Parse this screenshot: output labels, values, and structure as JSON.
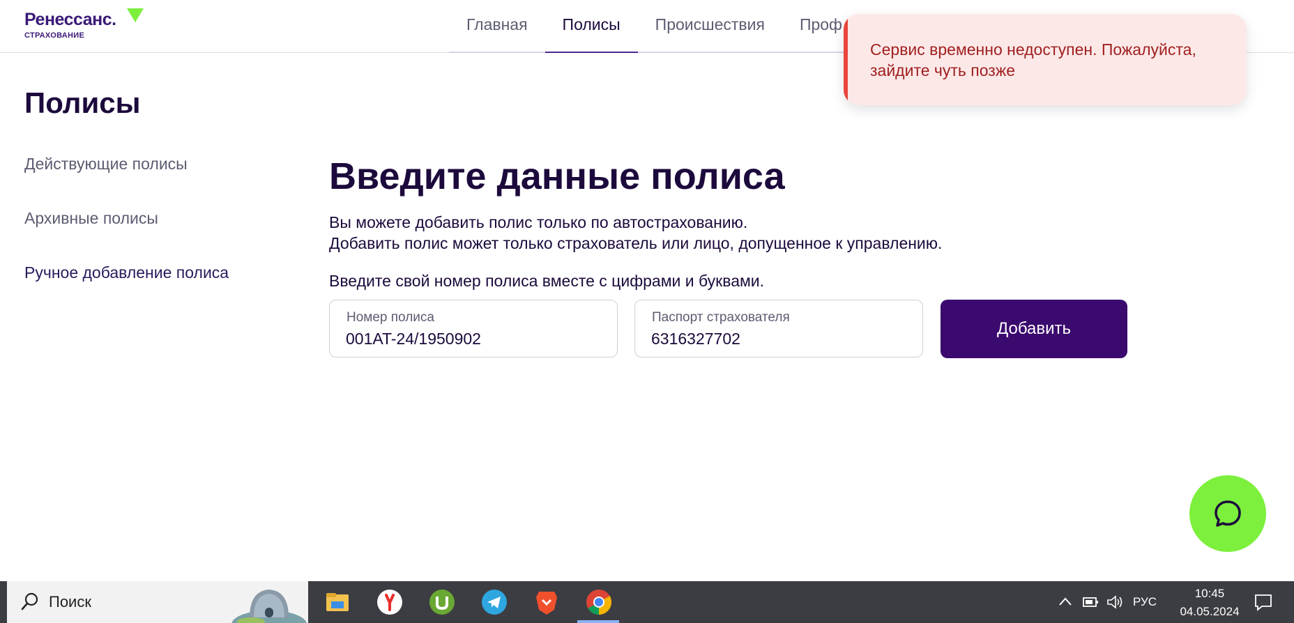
{
  "logo": {
    "name": "Ренессанс.",
    "sub": "СТРАХОВАНИЕ"
  },
  "nav": {
    "items": [
      {
        "label": "Главная"
      },
      {
        "label": "Полисы"
      },
      {
        "label": "Происшествия"
      },
      {
        "label": "Проф"
      }
    ],
    "active_index": 1
  },
  "toast": {
    "message": "Сервис временно недоступен. Пожалуйста, зайдите чуть позже"
  },
  "page": {
    "title": "Полисы"
  },
  "sidebar": {
    "items": [
      {
        "label": "Действующие полисы"
      },
      {
        "label": "Архивные полисы"
      },
      {
        "label": "Ручное добавление полиса"
      }
    ]
  },
  "form": {
    "title": "Введите данные полиса",
    "line1": "Вы можете добавить полис только по автострахованию.",
    "line2": "Добавить полис может только страхователь или лицо, допущенное к управлению.",
    "hint": "Введите свой номер полиса вместе с цифрами и буквами.",
    "policy_label": "Номер полиса",
    "policy_value": "001AT-24/1950902",
    "passport_label": "Паспорт страхователя",
    "passport_value": "6316327702",
    "submit_label": "Добавить"
  },
  "taskbar": {
    "search_text": "Поиск",
    "apps": [
      "file-explorer-icon",
      "yandex-browser-icon",
      "utorrent-icon",
      "telegram-icon",
      "brave-icon",
      "chrome-icon"
    ],
    "lang": "РУС",
    "time": "10:45",
    "date": "04.05.2024"
  },
  "colors": {
    "brand": "#3a0a6e",
    "accent": "#7cf03c",
    "error": "#a02020"
  }
}
